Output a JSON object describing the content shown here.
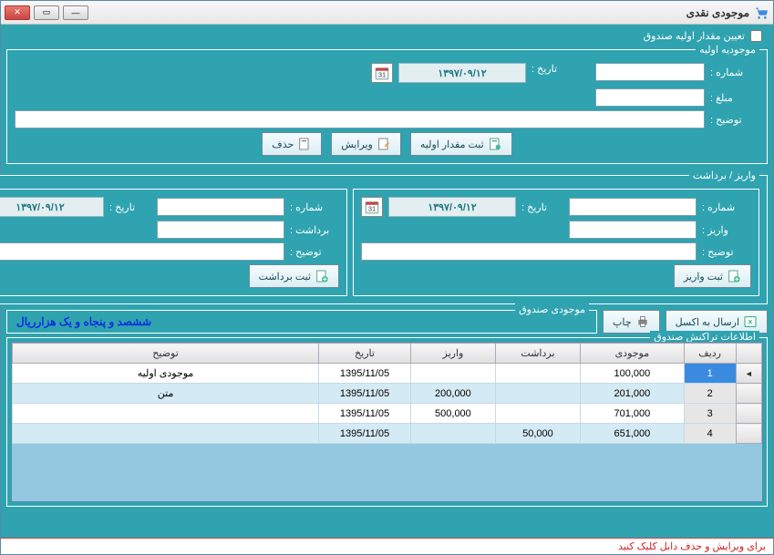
{
  "window": {
    "title": "موجودی نقدی"
  },
  "initial_checkbox_label": "تعیین مقدار اولیه صندوق",
  "groups": {
    "initial": "موجودیه اولیه",
    "depwd": "واریز / برداشت",
    "balance": "موجودی صندوق",
    "transactions": "اطلاعات تراکنش صندوق"
  },
  "labels": {
    "number": "شماره :",
    "amount": "مبلغ :",
    "desc": "توضیح :",
    "date": "تاریخ :",
    "deposit": "واریز :",
    "withdraw": "برداشت :"
  },
  "buttons": {
    "save_initial": "ثبت مقدار اولیه",
    "edit": "ویرایش",
    "delete": "حذف",
    "save_deposit": "ثبت واریز",
    "save_withdraw": "ثبت برداشت",
    "export_excel": "ارسال به اکسل",
    "print": "چاپ"
  },
  "dates": {
    "initial": "۱۳۹۷/۰۹/۱۲",
    "deposit": "۱۳۹۷/۰۹/۱۲",
    "withdraw": "۱۳۹۷/۰۹/۱۲"
  },
  "balance_text": "ششصد و پنجاه و یک هزارریال",
  "table": {
    "headers": {
      "row": "ردیف",
      "balance": "موجودی",
      "withdraw": "برداشت",
      "deposit": "واریز",
      "date": "تاریخ",
      "desc": "توضیح"
    },
    "rows": [
      {
        "idx": "1",
        "balance": "100,000",
        "withdraw": "",
        "deposit": "",
        "date": "1395/11/05",
        "desc": "موجودی اولیه",
        "selected": true
      },
      {
        "idx": "2",
        "balance": "201,000",
        "withdraw": "",
        "deposit": "200,000",
        "date": "1395/11/05",
        "desc": "متن"
      },
      {
        "idx": "3",
        "balance": "701,000",
        "withdraw": "",
        "deposit": "500,000",
        "date": "1395/11/05",
        "desc": ""
      },
      {
        "idx": "4",
        "balance": "651,000",
        "withdraw": "50,000",
        "deposit": "",
        "date": "1395/11/05",
        "desc": ""
      }
    ]
  },
  "footer_hint": "برای ویرایش و حذف دابل کلیک کنید"
}
